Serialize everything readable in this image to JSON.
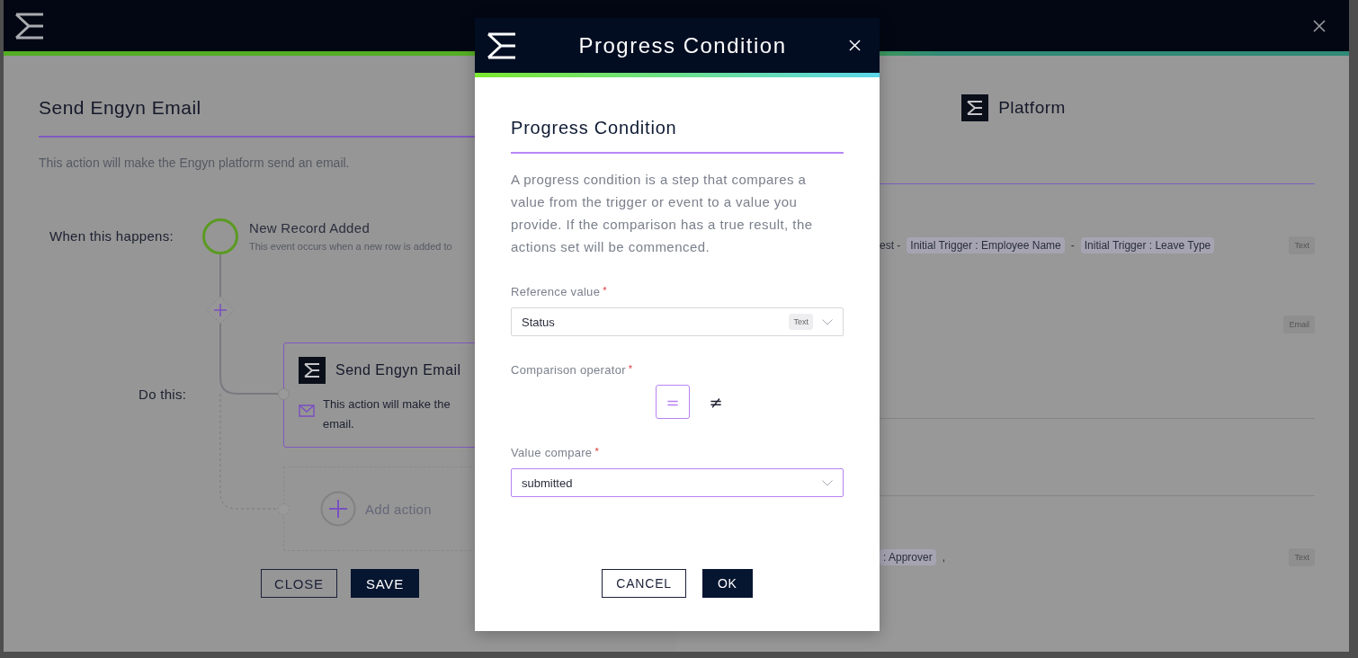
{
  "action": {
    "title": "Send Engyn Email",
    "description": "This action will make the Engyn platform send an email.",
    "trigger_label": "When this happens:",
    "trigger": {
      "name": "New Record Added",
      "description": "This event occurs when a new row is added to"
    },
    "do_label": "Do this:",
    "step": {
      "title": "Send Engyn Email",
      "description_lines": [
        "This action will make the",
        "email."
      ]
    },
    "add_label": "Add action",
    "buttons": [
      {
        "label": "CLOSE",
        "kind": "outline"
      },
      {
        "label": "SAVE",
        "kind": "primary"
      }
    ]
  },
  "platform": {
    "title": "Platform",
    "rows": [
      {
        "kind": "field",
        "parts": [
          {
            "text": "est -",
            "kind": "plain"
          },
          {
            "text": "Initial Trigger : Employee Name",
            "kind": "chip"
          },
          {
            "text": "-",
            "kind": "plain"
          },
          {
            "text": "Initial Trigger : Leave Type",
            "kind": "chip"
          }
        ],
        "type": "Text"
      },
      {
        "kind": "field",
        "type": "Email"
      },
      {
        "kind": "divider"
      },
      {
        "kind": "divider"
      },
      {
        "kind": "field",
        "parts": [
          {
            "text": ": Approver",
            "kind": "chip"
          },
          {
            "text": ",",
            "kind": "plain"
          }
        ],
        "type": "Text"
      }
    ]
  },
  "dialog": {
    "title": "Progress Condition",
    "heading": "Progress Condition",
    "description": "A progress condition is a step that compares a value from the trigger or event to a value you provide. If the comparison has a true result, the actions set will be commenced.",
    "fields": [
      {
        "kind": "select",
        "label": "Reference value",
        "required_mark": "*",
        "value": "Status",
        "type_tag": "Text",
        "focused": false
      },
      {
        "kind": "operator",
        "label": "Comparison operator",
        "required_mark": "*",
        "options": [
          {
            "symbol": "=",
            "selected": true
          },
          {
            "symbol": "≠",
            "selected": false
          }
        ]
      },
      {
        "kind": "select",
        "label": "Value compare",
        "required_mark": "*",
        "value": "submitted",
        "focused": true
      }
    ],
    "buttons": [
      {
        "label": "CANCEL",
        "kind": "outline"
      },
      {
        "label": "OK",
        "kind": "primary"
      }
    ]
  }
}
